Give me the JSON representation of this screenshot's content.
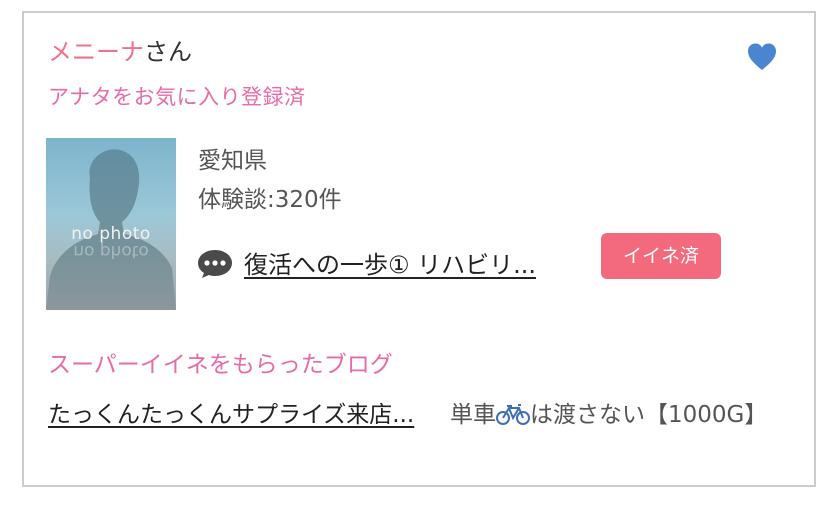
{
  "user": {
    "name": "メニーナ",
    "honorific": "さん",
    "favorite_status": "アナタをお気に入り登録済",
    "prefecture": "愛知県",
    "story_count_text": "体験談:320件",
    "avatar_placeholder": "no photo"
  },
  "latest_blog": {
    "title": "復活への一歩① リハビリ...",
    "like_button_label": "イイネ済"
  },
  "super_iine": {
    "section_title": "スーパーイイネをもらったブログ",
    "blog_title": "たっくんたっくんサプライズ来店...",
    "side_text_before_icon": "単車",
    "side_text_after_icon": "は渡さない【1000G】"
  },
  "colors": {
    "name_pink": "#f0708d",
    "accent_pink": "#e86aa8",
    "button_pink": "#f46a7d",
    "heart_blue": "#4a86d0"
  },
  "icons": [
    "heart-icon",
    "comment-icon",
    "bicycle-icon"
  ]
}
